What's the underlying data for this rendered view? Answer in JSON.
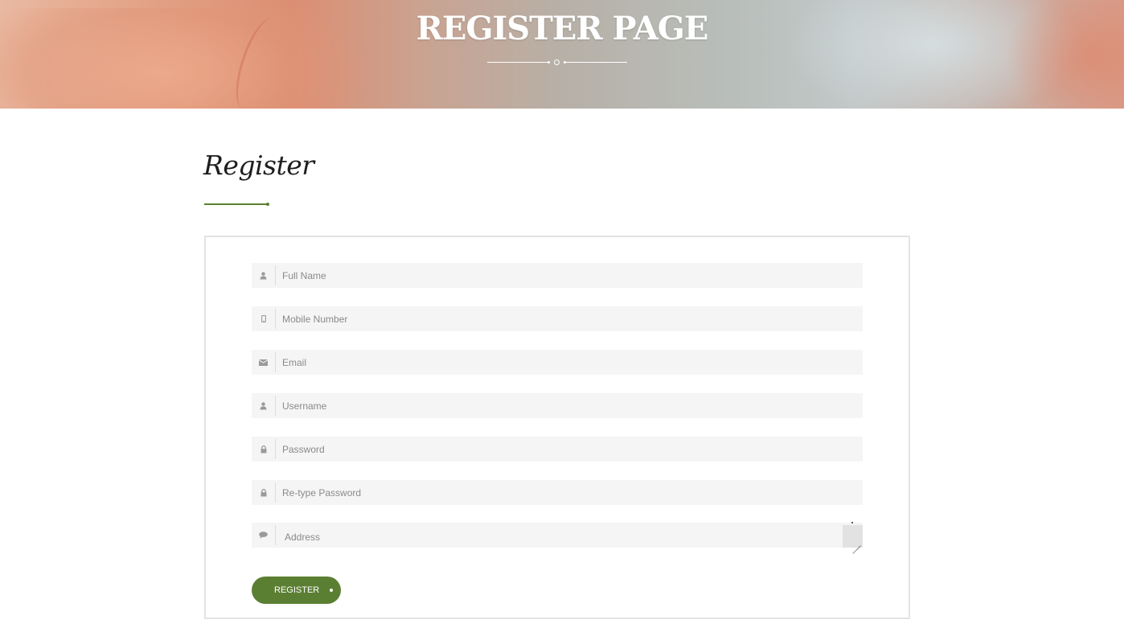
{
  "hero": {
    "title": "REGISTER PAGE"
  },
  "section": {
    "title": "Register"
  },
  "form": {
    "fields": [
      {
        "placeholder": "Full Name",
        "icon": "user-icon"
      },
      {
        "placeholder": "Mobile Number",
        "icon": "mobile-icon"
      },
      {
        "placeholder": "Email",
        "icon": "envelope-icon"
      },
      {
        "placeholder": "Username",
        "icon": "user-icon"
      },
      {
        "placeholder": "Password",
        "icon": "lock-icon"
      },
      {
        "placeholder": "Re-type Password",
        "icon": "lock-icon"
      },
      {
        "placeholder": "Address",
        "icon": "comment-icon"
      }
    ],
    "submit_label": "REGISTER"
  },
  "colors": {
    "accent": "#5b7f32",
    "field_bg": "#f5f5f5",
    "border": "#e3e3e3"
  }
}
